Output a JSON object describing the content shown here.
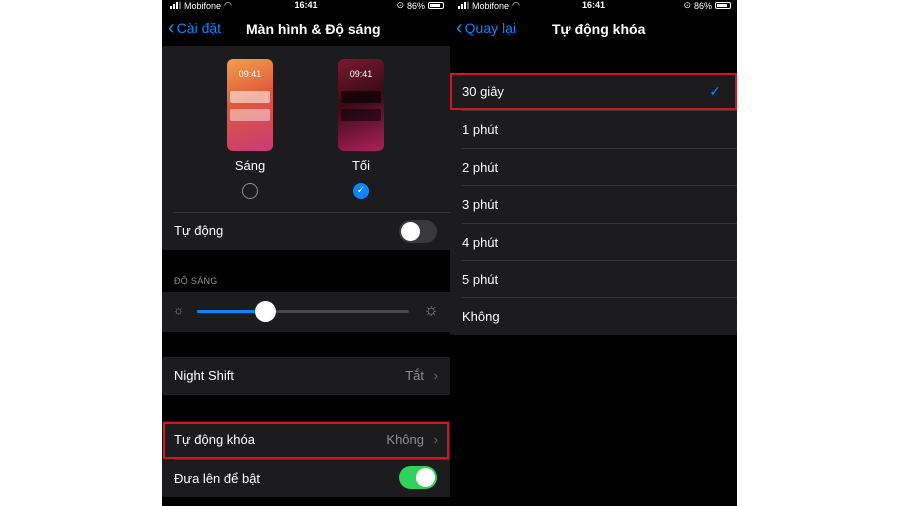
{
  "left": {
    "status": {
      "carrier": "Mobifone",
      "time": "16:41",
      "battery": "86%"
    },
    "nav": {
      "back_label": "Cài đặt",
      "title": "Màn hình & Độ sáng"
    },
    "appearance": {
      "light": {
        "time": "09:41",
        "label": "Sáng",
        "selected": false
      },
      "dark": {
        "time": "09:41",
        "label": "Tối",
        "selected": true
      }
    },
    "auto_label": "Tự động",
    "auto_on": false,
    "brightness_header": "ĐỘ SÁNG",
    "brightness_level": 0.32,
    "night_shift": {
      "label": "Night Shift",
      "value": "Tắt"
    },
    "auto_lock": {
      "label": "Tự động khóa",
      "value": "Không"
    },
    "raise_to_wake": {
      "label": "Đưa lên để bật",
      "on": true
    }
  },
  "right": {
    "status": {
      "carrier": "Mobifone",
      "time": "16:41",
      "battery": "86%"
    },
    "nav": {
      "back_label": "Quay lại",
      "title": "Tự động khóa"
    },
    "options": [
      "30 giây",
      "1 phút",
      "2 phút",
      "3 phút",
      "4 phút",
      "5 phút",
      "Không"
    ],
    "selected_index": 0
  },
  "colors": {
    "accent": "#0a84ff",
    "highlight": "#d0171b",
    "toggle_on": "#30d158",
    "cell": "#1c1c1e"
  }
}
